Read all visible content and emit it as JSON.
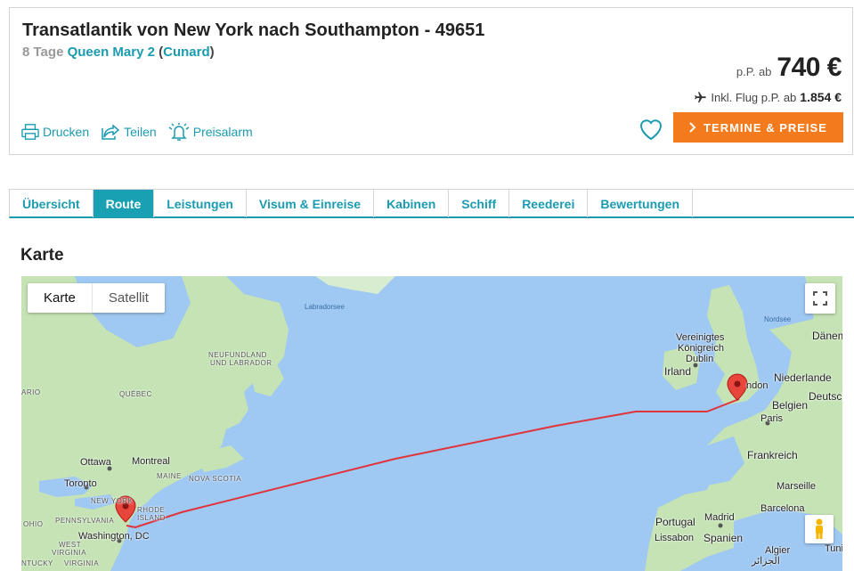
{
  "header": {
    "title": "Transatlantik von New York nach Southampton - 49651",
    "duration": "8 Tage",
    "ship": "Queen Mary 2",
    "paren_open": "(",
    "line": "Cunard",
    "paren_close": ")",
    "price_prefix": "p.P. ab",
    "price": "740 €",
    "flight_prefix": "Inkl. Flug p.P. ab",
    "flight_price": "1.854 €"
  },
  "actions": [
    {
      "label": "Drucken",
      "icon": "printer-icon"
    },
    {
      "label": "Teilen",
      "icon": "share-icon"
    },
    {
      "label": "Preisalarm",
      "icon": "bell-icon"
    }
  ],
  "cta": {
    "label": "TERMINE & PREISE",
    "icon": "chevron-right-icon",
    "color": "#f37b1d"
  },
  "tabs": [
    {
      "label": "Übersicht",
      "active": false
    },
    {
      "label": "Route",
      "active": true
    },
    {
      "label": "Leistungen",
      "active": false
    },
    {
      "label": "Visum & Einreise",
      "active": false
    },
    {
      "label": "Kabinen",
      "active": false
    },
    {
      "label": "Schiff",
      "active": false
    },
    {
      "label": "Reederei",
      "active": false
    },
    {
      "label": "Bewertungen",
      "active": false
    }
  ],
  "section": {
    "title": "Karte"
  },
  "map": {
    "type_map": "Karte",
    "type_satellite": "Satellit",
    "labels": {
      "labradorsee": "Labradorsee",
      "nordsee": "Nordsee",
      "neufundland": "NEUFUNDLAND",
      "und_labrador": "UND LABRADOR",
      "quebec": "QUÉBEC",
      "ario": "ARIO",
      "ottawa": "Ottawa",
      "montreal": "Montreal",
      "maine": "MAINE",
      "nova_scotia": "NOVA SCOTIA",
      "toronto": "Toronto",
      "new_york": "NEW YORK",
      "rhode": "RHODE",
      "island": "ISLAND",
      "pennsylvania": "PENNSYLVANIA",
      "ohio": "OHIO",
      "washington": "Washington, DC",
      "west": "WEST",
      "virginia": "VIRGINIA",
      "ntucky": "NTUCKY",
      "virginia2": "VIRGINIA",
      "vereinigtes": "Vereinigtes",
      "koenigreich": "Königreich",
      "dublin": "Dublin",
      "irland": "Irland",
      "london": "ndon",
      "daenem": "Dänem",
      "niederlande": "Niederlande",
      "belgien": "Belgien",
      "deutsch": "Deutsch",
      "paris": "Paris",
      "frankreich": "Frankreich",
      "marseille": "Marseille",
      "barcelona": "Barcelona",
      "portugal": "Portugal",
      "madrid": "Madrid",
      "spanien": "Spanien",
      "lissabon": "Lissabon",
      "algier": "Algier",
      "tunis": "Tunis",
      "arabic": "الجزائر"
    },
    "route_color": "#e0343b",
    "water_color": "#9fc8f3",
    "land_color": "#c5e3b5"
  }
}
